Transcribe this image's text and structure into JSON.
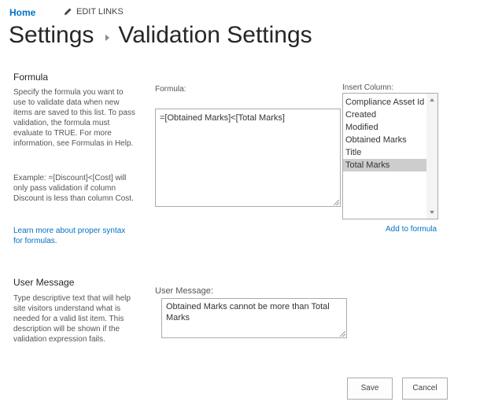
{
  "topnav": {
    "home": "Home",
    "edit_links": "EDIT LINKS"
  },
  "title": {
    "parent": "Settings",
    "current": "Validation Settings"
  },
  "formula_section": {
    "heading": "Formula",
    "description": "Specify the formula you want to use to validate data when new items are saved to this list. To pass validation, the formula must evaluate to TRUE. For more information, see Formulas in Help.",
    "example": "Example: =[Discount]<[Cost] will only pass validation if column Discount is less than column Cost.",
    "learn_more_link": "Learn more about proper syntax for formulas.",
    "formula_label": "Formula:",
    "formula_value": "=[Obtained Marks]<[Total Marks]",
    "insert_column_label": "Insert Column:",
    "columns": [
      "Compliance Asset Id",
      "Created",
      "Modified",
      "Obtained Marks",
      "Title",
      "Total Marks"
    ],
    "selected_column": "Total Marks",
    "add_to_formula": "Add to formula"
  },
  "message_section": {
    "heading": "User Message",
    "description": "Type descriptive text that will help site visitors understand what is needed for a valid list item. This description will be shown if the validation expression fails.",
    "message_label": "User Message:",
    "message_value": "Obtained Marks cannot be more than Total Marks"
  },
  "buttons": {
    "save": "Save",
    "cancel": "Cancel"
  },
  "colors": {
    "link": "#0072c6",
    "selected_item": "#cdcdcd"
  }
}
